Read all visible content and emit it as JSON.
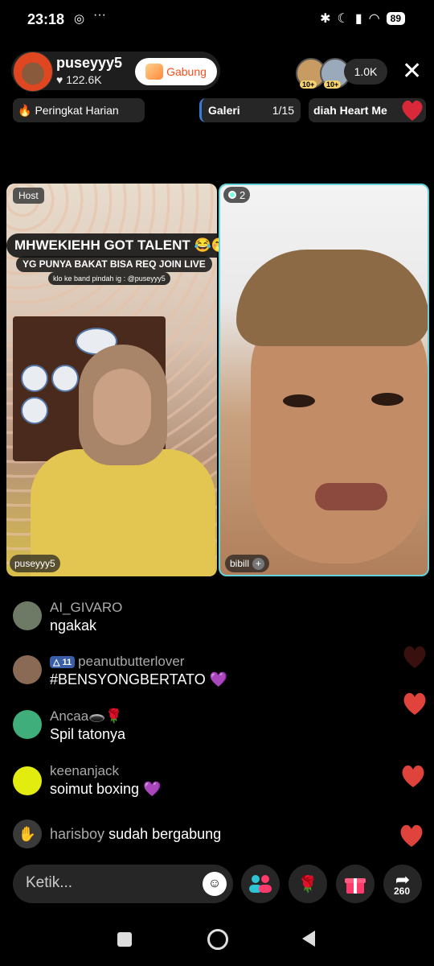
{
  "status_bar": {
    "time": "23:18",
    "wa_icon": "whatsapp-icon",
    "more": "···",
    "battery": "89"
  },
  "header": {
    "host_name": "puseyyy5",
    "host_likes": "♥ 122.6K",
    "join_label": "Gabung",
    "viewer_badge_1": "10+",
    "viewer_badge_2": "10+",
    "viewer_count": "1.0K",
    "close": "✕"
  },
  "chips": {
    "rank_label": "Peringkat Harian",
    "gallery_label": "Galeri",
    "gallery_count": "1/15",
    "heart_label": "diah Heart Me"
  },
  "left_pane": {
    "host_tag": "Host",
    "banner_title": "MHWEKIEHH GOT TALENT 😂🤭",
    "banner_sub": "YG PUNYA BAKAT BISA REQ JOIN LIVE",
    "banner_small": "klo ke band pindah ig : @puseyyy5",
    "name": "puseyyy5"
  },
  "right_pane": {
    "guest_count": "2",
    "name": "bibill",
    "plus": "+"
  },
  "comments": [
    {
      "name": "AI_GIVARO",
      "text": "ngakak",
      "avatar_color": "#6f7a66"
    },
    {
      "name": "peanutbutterlover",
      "level": "11",
      "text": "#BENSYONGBERTATO 💜",
      "avatar_color": "#8a6a55"
    },
    {
      "name": "Ancaa🕳️🌹",
      "text": "Spil tatonya",
      "avatar_color": "#3fae7a"
    },
    {
      "name": "keenanjack",
      "text": "soimut boxing 💜",
      "avatar_color": "#e2ec0e"
    }
  ],
  "join_event": {
    "user": "harisboy",
    "text": "sudah bergabung"
  },
  "bottom": {
    "input_placeholder": "Ketik...",
    "share_count": "260"
  },
  "colors": {
    "heart": "#e0433c",
    "join_text": "#f4511e",
    "guest_border": "#64d2d8"
  }
}
